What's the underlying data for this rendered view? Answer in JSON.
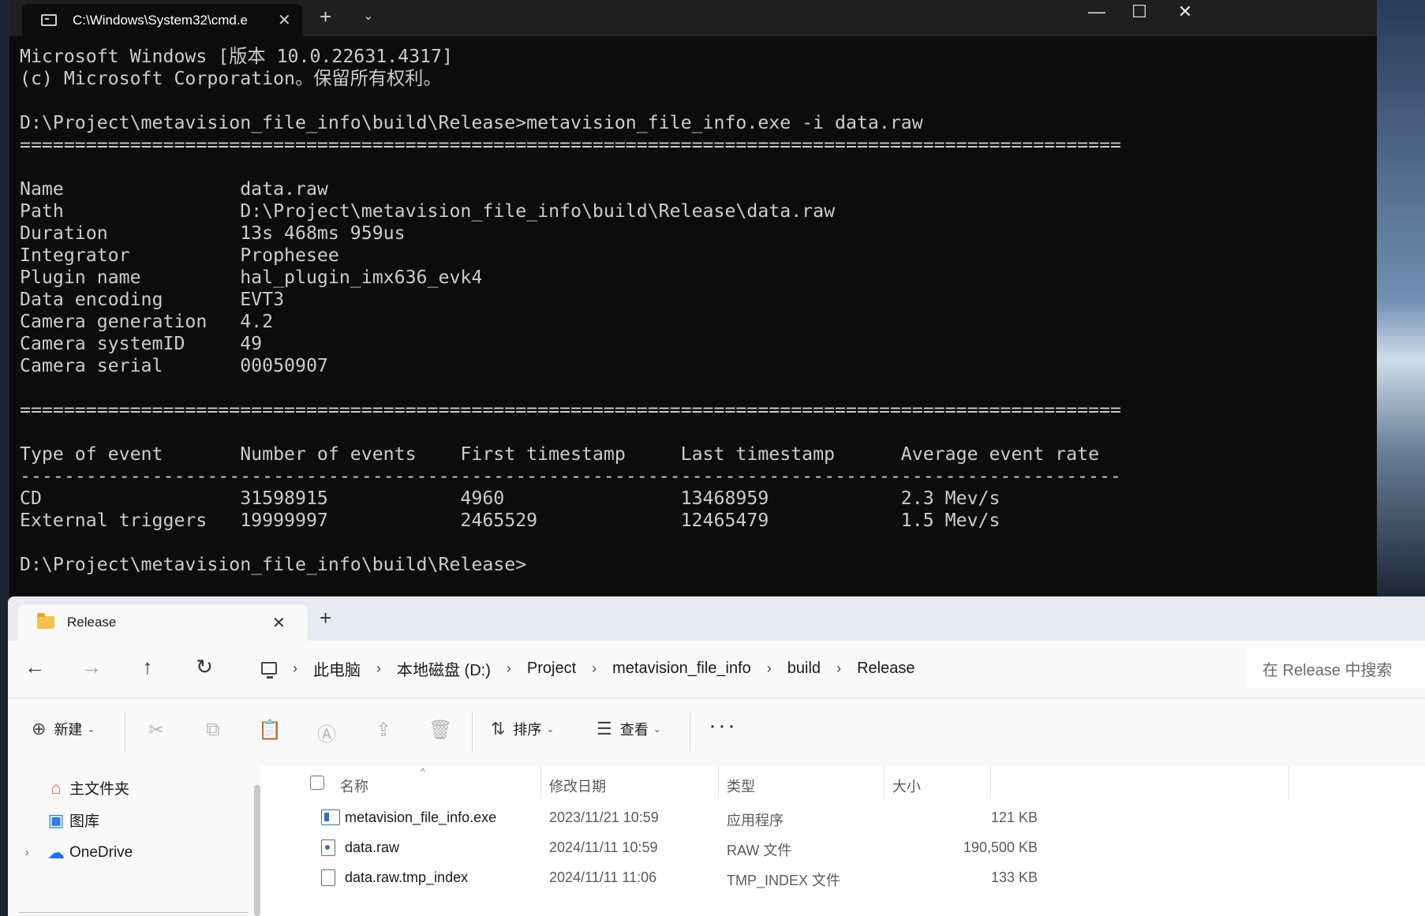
{
  "cmd": {
    "tab_title": "C:\\Windows\\System32\\cmd.e",
    "close_glyph": "✕",
    "new_tab_glyph": "+",
    "dropdown_glyph": "⌄",
    "window_controls": {
      "minimize": "—",
      "maximize": "☐",
      "close": "✕"
    },
    "lines": [
      "Microsoft Windows [版本 10.0.22631.4317]",
      "(c) Microsoft Corporation。保留所有权利。",
      "",
      "D:\\Project\\metavision_file_info\\build\\Release>metavision_file_info.exe -i data.raw",
      "====================================================================================================",
      "",
      "Name                data.raw",
      "Path                D:\\Project\\metavision_file_info\\build\\Release\\data.raw",
      "Duration            13s 468ms 959us",
      "Integrator          Prophesee",
      "Plugin name         hal_plugin_imx636_evk4",
      "Data encoding       EVT3",
      "Camera generation   4.2",
      "Camera systemID     49",
      "Camera serial       00050907",
      "",
      "====================================================================================================",
      "",
      "Type of event       Number of events    First timestamp     Last timestamp      Average event rate",
      "----------------------------------------------------------------------------------------------------",
      "CD                  31598915            4960                13468959            2.3 Mev/s",
      "External triggers   19999997            2465529             12465479            1.5 Mev/s",
      "",
      "D:\\Project\\metavision_file_info\\build\\Release>"
    ]
  },
  "explorer": {
    "tab_title": "Release",
    "close_glyph": "✕",
    "new_tab_glyph": "+",
    "nav": {
      "back": "←",
      "forward": "→",
      "up": "↑",
      "refresh": "↻"
    },
    "breadcrumb": [
      "此电脑",
      "本地磁盘 (D:)",
      "Project",
      "metavision_file_info",
      "build",
      "Release"
    ],
    "breadcrumb_sep": "›",
    "search_placeholder": "在 Release 中搜索",
    "toolbar": {
      "new_label": "新建",
      "sort_label": "排序",
      "view_label": "查看",
      "more_glyph": "···",
      "chevron": "⌄",
      "plus_glyph": "⊕",
      "sort_glyph": "⇅",
      "view_glyph": "☰",
      "cut_glyph": "✂",
      "copy_glyph": "⧉",
      "paste_glyph": "📋",
      "rename_glyph": "Ⓐ",
      "share_glyph": "⇪",
      "delete_glyph": "🗑"
    },
    "sidebar": {
      "items": [
        {
          "label": "主文件夹",
          "icon": "home-icon",
          "glyph": "⌂",
          "color": "#e0593d"
        },
        {
          "label": "图库",
          "icon": "gallery-icon",
          "glyph": "▣",
          "color": "#2f7ed8"
        },
        {
          "label": "OneDrive",
          "icon": "cloud-icon",
          "glyph": "☁",
          "color": "#1a73e8"
        }
      ],
      "expand_glyph": "›"
    },
    "columns": {
      "name": "名称",
      "date": "修改日期",
      "type": "类型",
      "size": "大小",
      "sort_glyph": "^"
    },
    "files": [
      {
        "name": "metavision_file_info.exe",
        "date": "2023/11/21 10:59",
        "type": "应用程序",
        "size": "121 KB",
        "kind": "exe"
      },
      {
        "name": "data.raw",
        "date": "2024/11/11 10:59",
        "type": "RAW 文件",
        "size": "190,500 KB",
        "kind": "raw"
      },
      {
        "name": "data.raw.tmp_index",
        "date": "2024/11/11 11:06",
        "type": "TMP_INDEX 文件",
        "size": "133 KB",
        "kind": "file"
      }
    ]
  }
}
